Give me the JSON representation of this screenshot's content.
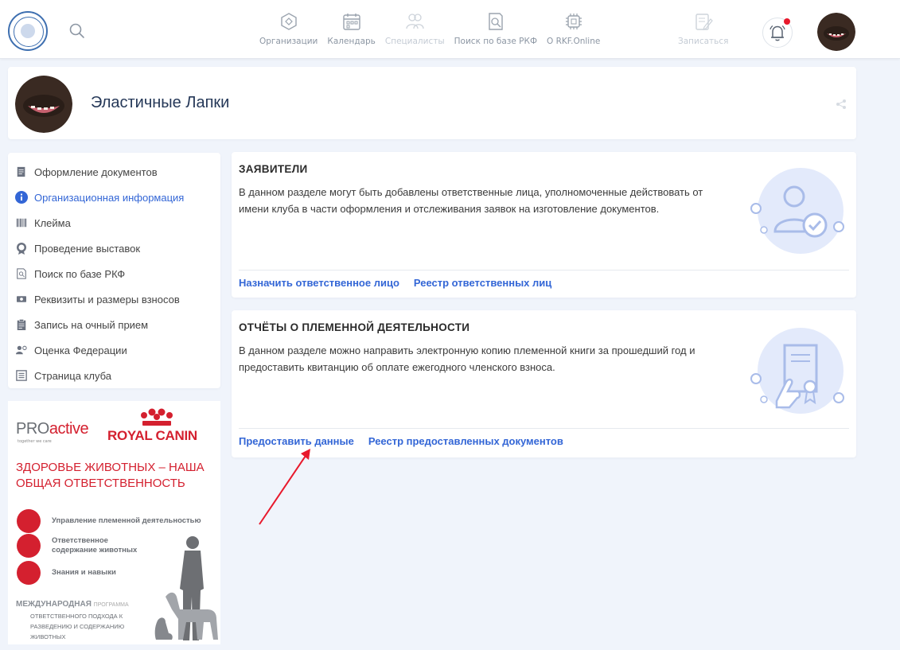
{
  "header": {
    "nav": [
      {
        "label": "Организации",
        "icon": "organizations-icon",
        "disabled": false
      },
      {
        "label": "Календарь",
        "icon": "calendar-icon",
        "disabled": false
      },
      {
        "label": "Специалисты",
        "icon": "specialists-icon",
        "disabled": true
      },
      {
        "label": "Поиск по базе РКФ",
        "icon": "database-search-icon",
        "disabled": false
      },
      {
        "label": "О RKF.Online",
        "icon": "chip-icon",
        "disabled": false
      }
    ],
    "signup_label": "Записаться",
    "notification_dot": true
  },
  "profile": {
    "name": "Эластичные Лапки"
  },
  "sidebar": {
    "items": [
      {
        "label": "Оформление документов",
        "icon": "document-icon",
        "active": false
      },
      {
        "label": "Организационная информация",
        "icon": "info-icon",
        "active": true
      },
      {
        "label": "Клейма",
        "icon": "barcode-icon",
        "active": false
      },
      {
        "label": "Проведение выставок",
        "icon": "medal-icon",
        "active": false
      },
      {
        "label": "Поиск по базе РКФ",
        "icon": "database-search-icon",
        "active": false
      },
      {
        "label": "Реквизиты и размеры взносов",
        "icon": "money-icon",
        "active": false
      },
      {
        "label": "Запись на очный прием",
        "icon": "clipboard-icon",
        "active": false
      },
      {
        "label": "Оценка Федерации",
        "icon": "rating-icon",
        "active": false
      },
      {
        "label": "Страница клуба",
        "icon": "page-icon",
        "active": false
      }
    ]
  },
  "ad": {
    "proactive_pro": "PRO",
    "proactive_rest": "active",
    "proactive_sub": "together we care",
    "brand": "ROYAL CANIN",
    "headline": "ЗДОРОВЬЕ ЖИВОТНЫХ – НАША ОБЩАЯ ОТВЕТСТВЕННОСТЬ",
    "rows": [
      "Управление племенной деятельностью",
      "Ответственное содержание животных",
      "Знания и навыки"
    ],
    "intl_bold": "МЕЖДУНАРОДНАЯ",
    "intl_small": "ПРОГРАММА",
    "intl_sub": "ОТВЕТСТВЕННОГО ПОДХОДА К РАЗВЕДЕНИЮ И СОДЕРЖАНИЮ ЖИВОТНЫХ"
  },
  "sections": [
    {
      "title": "ЗАЯВИТЕЛИ",
      "text": "В данном разделе могут быть добавлены ответственные лица, уполномоченные действовать от имени клуба в части оформления и отслеживания заявок на изготовление документов.",
      "links": [
        "Назначить ответственное лицо",
        "Реестр ответственных лиц"
      ],
      "illustration": "user-check-icon"
    },
    {
      "title": "ОТЧЁТЫ О ПЛЕМЕННОЙ ДЕЯТЕЛЬНОСТИ",
      "text": "В данном разделе можно направить электронную копию племенной книги за прошедший год и предоставить квитанцию об оплате ежегодного членского взноса.",
      "links": [
        "Предоставить данные",
        "Реестр предоставленных документов"
      ],
      "illustration": "certificate-icon"
    }
  ],
  "colors": {
    "accent": "#3366d6",
    "brand_red": "#d4202f",
    "annotation_arrow": "#e8192c"
  }
}
